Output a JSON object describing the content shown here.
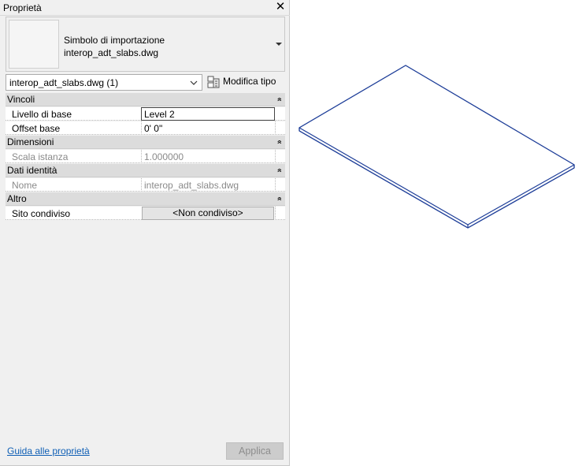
{
  "panel": {
    "title": "Proprietà",
    "close_glyph": "✕"
  },
  "type_selector": {
    "line1": "Simbolo di importazione",
    "line2": "interop_adt_slabs.dwg"
  },
  "instance_filter": {
    "value": "interop_adt_slabs.dwg (1)",
    "edit_type_label": "Modifica tipo"
  },
  "groups": [
    {
      "label": "Vincoli",
      "collapse_glyph": "»"
    },
    {
      "label": "Dimensioni",
      "collapse_glyph": "»"
    },
    {
      "label": "Dati identità",
      "collapse_glyph": "»"
    },
    {
      "label": "Altro",
      "collapse_glyph": "»"
    }
  ],
  "properties": {
    "livello_di_base": {
      "label": "Livello di base",
      "value": "Level 2"
    },
    "offset_base": {
      "label": "Offset base",
      "value": "0'  0\""
    },
    "scala_istanza": {
      "label": "Scala istanza",
      "value": "1.000000"
    },
    "nome": {
      "label": "Nome",
      "value": "interop_adt_slabs.dwg"
    },
    "sito_condiviso": {
      "label": "Sito condiviso",
      "value": "<Non condiviso>"
    }
  },
  "footer": {
    "help_link": "Guida alle proprietà",
    "apply_label": "Applica"
  },
  "colors": {
    "link": "#0f5fb5",
    "slab_outline": "#1f3f99"
  }
}
